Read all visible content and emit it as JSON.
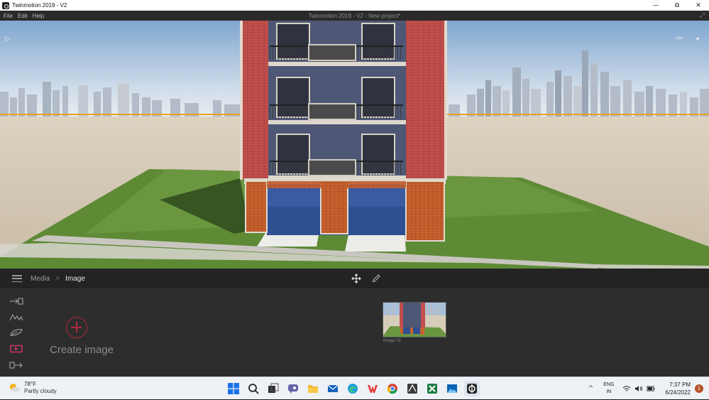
{
  "window": {
    "app_title": "Twinmotion 2019 - V2",
    "minimize_glyph": "—",
    "maximize_glyph": "⧉",
    "close_glyph": "✕"
  },
  "menubar": {
    "items": [
      {
        "label": "File"
      },
      {
        "label": "Edit"
      },
      {
        "label": "Help"
      }
    ],
    "document_title": "Twinmotion 2019 - V2 - New project*"
  },
  "viewport": {
    "left_toggle_glyph": "▷",
    "right_toggle_glyph": "◂",
    "top_right_label": "</>",
    "expand_glyph": "⤢"
  },
  "panel": {
    "breadcrumb": {
      "parent": "Media",
      "separator": ">",
      "current": "Image"
    },
    "side_icons": [
      "import-icon",
      "landscape-icon",
      "leaf-icon",
      "media-icon",
      "export-icon"
    ],
    "create_label": "Create image",
    "thumbnail_label": "Image 01",
    "accent_color": "#b3263e"
  },
  "taskbar": {
    "weather": {
      "temp": "78°F",
      "desc": "Partly cloudy"
    },
    "pinned_apps": [
      "windows-start-icon",
      "search-icon",
      "task-view-icon",
      "teams-chat-icon",
      "file-explorer-icon",
      "mail-icon",
      "edge-icon",
      "wps-office-icon",
      "chrome-icon",
      "vectorworks-icon",
      "excel-icon",
      "photos-icon",
      "twinmotion-icon"
    ],
    "tray_chevron": "^",
    "language": {
      "line1": "ENG",
      "line2": "IN"
    },
    "clock": {
      "time": "7:37 PM",
      "date": "6/24/2022"
    },
    "notification_count": "1"
  }
}
